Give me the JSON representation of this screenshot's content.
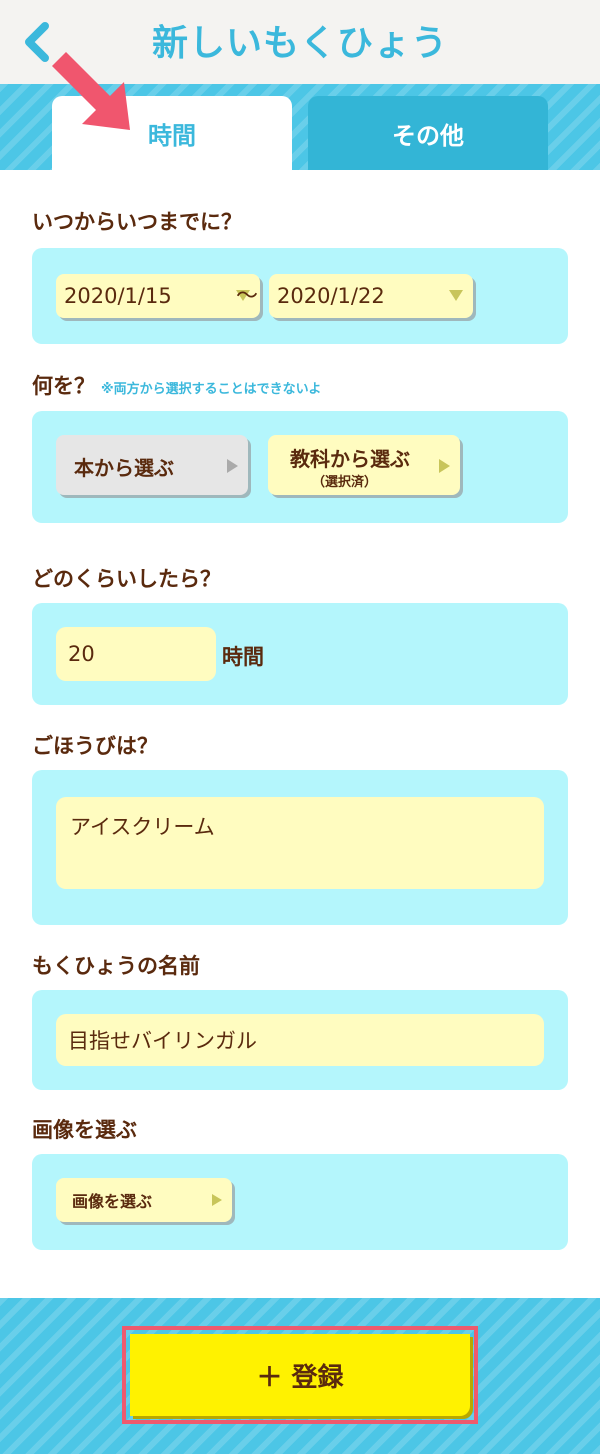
{
  "header": {
    "title": "新しいもくひょう"
  },
  "tabs": [
    {
      "label": "時間",
      "active": true
    },
    {
      "label": "その他",
      "active": false
    }
  ],
  "period": {
    "label": "いつからいつまでに？",
    "start": "2020/1/15",
    "separator": "～",
    "end": "2020/1/22"
  },
  "what": {
    "label": "何を？",
    "note": "※両方から選択することはできないよ",
    "book_button": "本から選ぶ",
    "subject_button": "教科から選ぶ",
    "subject_status": "（選択済）"
  },
  "amount": {
    "label": "どのくらいしたら？",
    "value": "20",
    "unit": "時間"
  },
  "reward": {
    "label": "ごほうびは？",
    "value": "アイスクリーム"
  },
  "goal_name": {
    "label": "もくひょうの名前",
    "value": "目指せバイリンガル"
  },
  "image": {
    "label": "画像を選ぶ",
    "button": "画像を選ぶ"
  },
  "register": {
    "label": "＋ 登録"
  },
  "colors": {
    "accent": "#3bb8dc",
    "panel": "#b4f6fc",
    "field": "#fffcc0",
    "text": "#5a2a0e",
    "register": "#fff200",
    "highlight": "#ee5a6e"
  }
}
